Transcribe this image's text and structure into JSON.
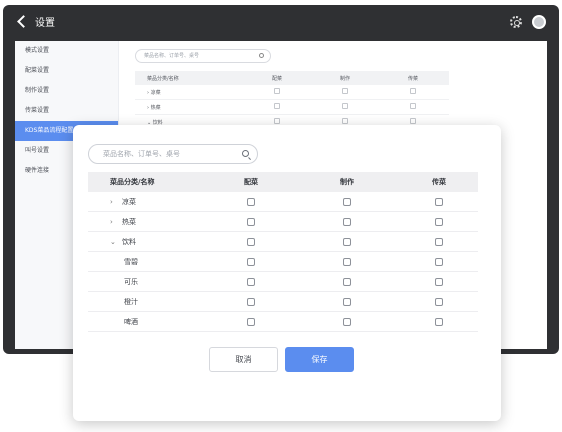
{
  "window": {
    "title": "设置"
  },
  "sidebar": {
    "items": [
      {
        "label": "模式设置"
      },
      {
        "label": "配菜设置"
      },
      {
        "label": "制作设置"
      },
      {
        "label": "传菜设置"
      },
      {
        "label": "KDS菜品流程配置"
      },
      {
        "label": "叫号设置"
      },
      {
        "label": "硬件连接"
      }
    ],
    "active_index": 4
  },
  "background_panel": {
    "search_placeholder": "菜品名称、订单号、桌号",
    "columns": [
      "菜品分类/名称",
      "配菜",
      "制作",
      "传菜"
    ],
    "rows": [
      {
        "label": "凉菜",
        "expanded": false
      },
      {
        "label": "热菜",
        "expanded": false
      },
      {
        "label": "饮料",
        "expanded": true
      }
    ]
  },
  "dialog": {
    "search_placeholder": "菜品名称、订单号、桌号",
    "columns": [
      "菜品分类/名称",
      "配菜",
      "制作",
      "传菜"
    ],
    "rows": [
      {
        "label": "凉菜",
        "type": "category",
        "expanded": false
      },
      {
        "label": "热菜",
        "type": "category",
        "expanded": false
      },
      {
        "label": "饮料",
        "type": "category",
        "expanded": true
      },
      {
        "label": "雪碧",
        "type": "item"
      },
      {
        "label": "可乐",
        "type": "item"
      },
      {
        "label": "橙汁",
        "type": "item"
      },
      {
        "label": "啤酒",
        "type": "item"
      }
    ],
    "cancel_label": "取消",
    "save_label": "保存"
  },
  "colors": {
    "accent": "#5b8def",
    "window_frame": "#2f3033",
    "header_bg": "#efeff1"
  }
}
